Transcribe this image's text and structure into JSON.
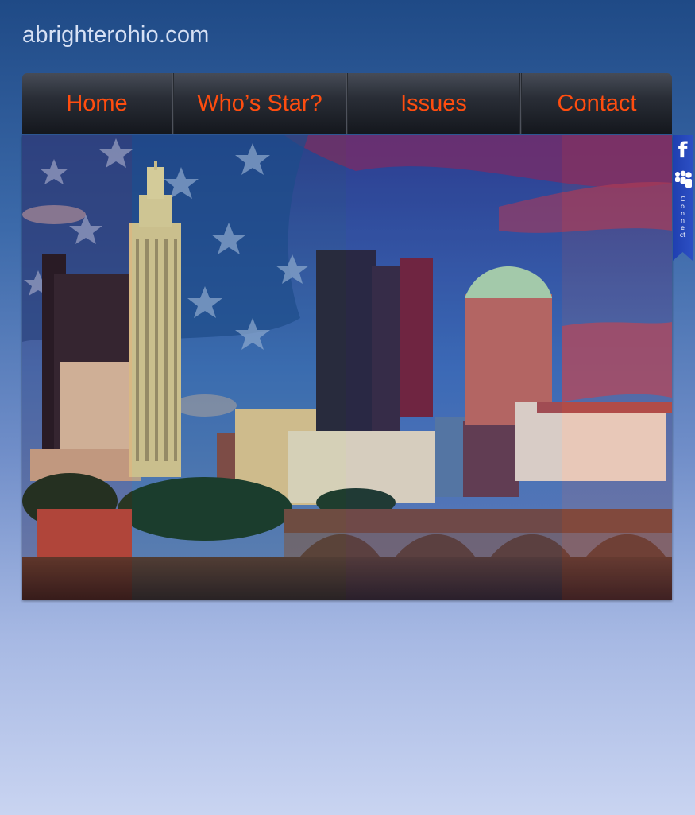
{
  "site": {
    "title": "abrighterohio.com"
  },
  "nav": {
    "items": [
      {
        "label": "Home",
        "name": "nav-home"
      },
      {
        "label": "Who’s Star?",
        "name": "nav-whos-star"
      },
      {
        "label": "Issues",
        "name": "nav-issues"
      },
      {
        "label": "Contact",
        "name": "nav-contact"
      }
    ]
  },
  "hero": {
    "description_icon": "columbus-skyline-flag-image"
  },
  "social": {
    "facebook_icon": "facebook-icon",
    "myspace_icon": "myspace-icon",
    "label": "Connect"
  },
  "colors": {
    "nav_text": "#ff4d0f",
    "title_text": "#d6e0f4",
    "social_bar": "#2443b8"
  }
}
